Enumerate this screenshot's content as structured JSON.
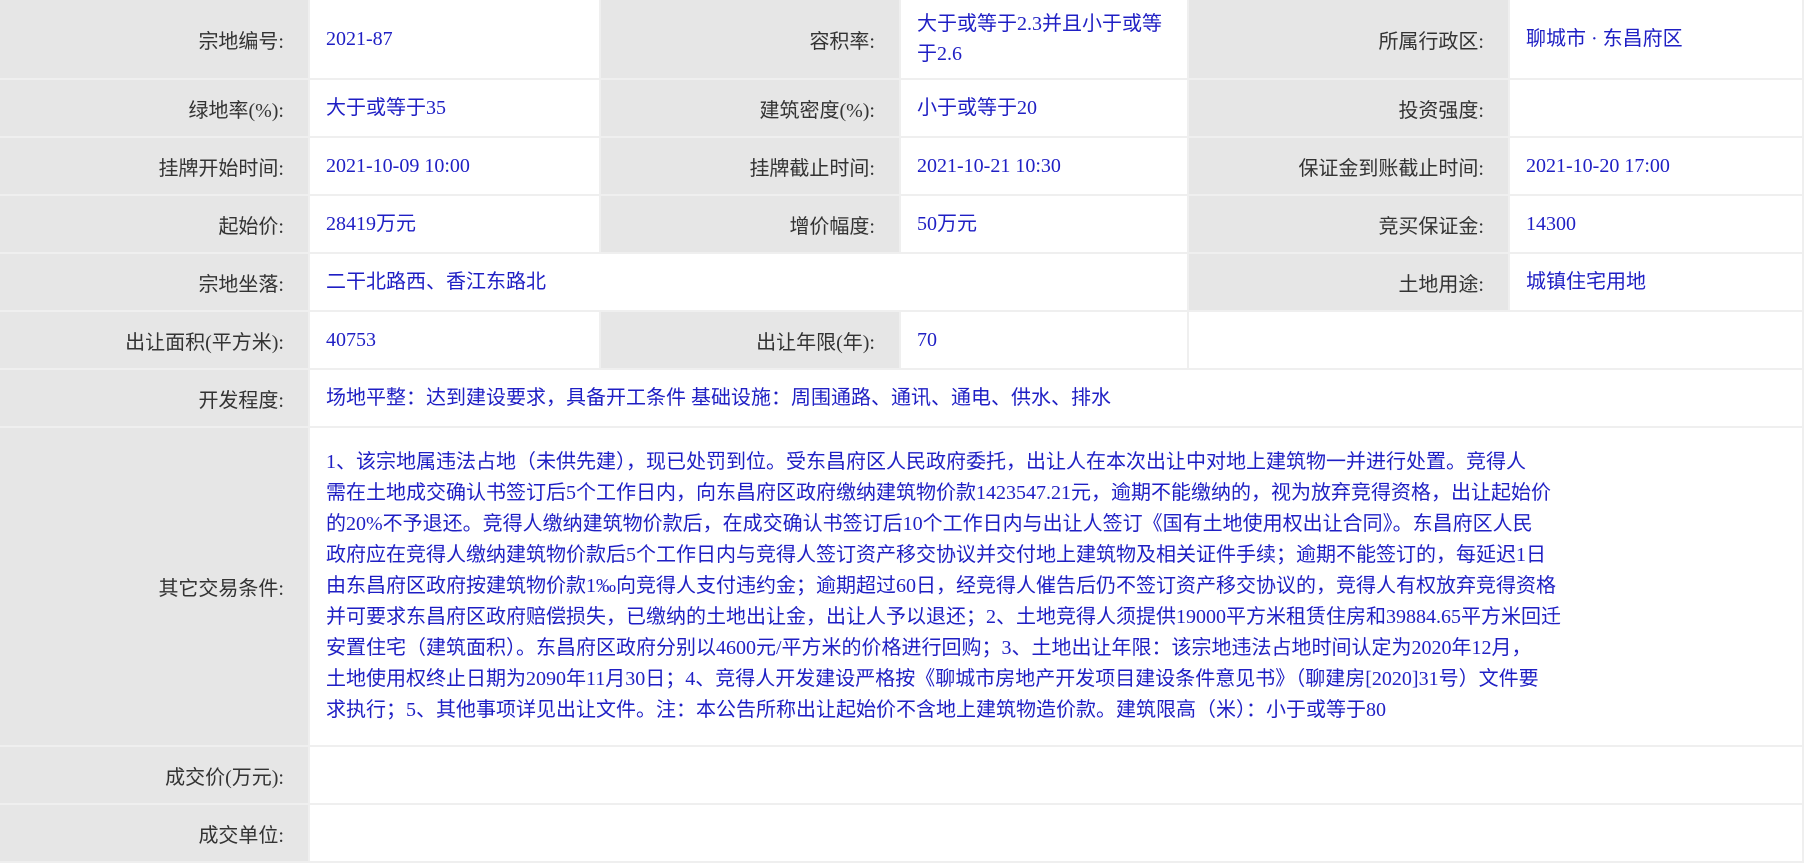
{
  "rows": {
    "parcel_no": {
      "label": "宗地编号:",
      "value": "2021-87"
    },
    "plot_ratio": {
      "label": "容积率:",
      "value": "大于或等于2.3并且小于或等于2.6"
    },
    "district": {
      "label": "所属行政区:",
      "value": "聊城市 · 东昌府区"
    },
    "green_ratio": {
      "label": "绿地率(%):",
      "value": "大于或等于35"
    },
    "building_density": {
      "label": "建筑密度(%):",
      "value": "小于或等于20"
    },
    "investment_intensity": {
      "label": "投资强度:",
      "value": ""
    },
    "listing_start": {
      "label": "挂牌开始时间:",
      "value": "2021-10-09 10:00"
    },
    "listing_end": {
      "label": "挂牌截止时间:",
      "value": "2021-10-21 10:30"
    },
    "deposit_deadline": {
      "label": "保证金到账截止时间:",
      "value": "2021-10-20 17:00"
    },
    "start_price": {
      "label": "起始价:",
      "value": "28419万元"
    },
    "increment": {
      "label": "增价幅度:",
      "value": "50万元"
    },
    "bid_deposit": {
      "label": "竞买保证金:",
      "value": "14300"
    },
    "location": {
      "label": "宗地坐落:",
      "value": "二干北路西、香江东路北"
    },
    "land_use": {
      "label": "土地用途:",
      "value": "城镇住宅用地"
    },
    "area": {
      "label": "出让面积(平方米):",
      "value": "40753"
    },
    "term": {
      "label": "出让年限(年):",
      "value": "70"
    },
    "development": {
      "label": "开发程度:",
      "value": "场地平整：达到建设要求，具备开工条件 基础设施：周围通路、通讯、通电、供水、排水"
    },
    "other_conditions": {
      "label": "其它交易条件:",
      "lines": [
        "1、该宗地属违法占地（未供先建），现已处罚到位。受东昌府区人民政府委托，出让人在本次出让中对地上建筑物一并进行处置。竞得人",
        "需在土地成交确认书签订后5个工作日内，向东昌府区政府缴纳建筑物价款1423547.21元，逾期不能缴纳的，视为放弃竞得资格，出让起始价",
        "的20%不予退还。竞得人缴纳建筑物价款后，在成交确认书签订后10个工作日内与出让人签订《国有土地使用权出让合同》。东昌府区人民",
        "政府应在竞得人缴纳建筑物价款后5个工作日内与竞得人签订资产移交协议并交付地上建筑物及相关证件手续；逾期不能签订的，每延迟1日",
        "由东昌府区政府按建筑物价款1‰向竞得人支付违约金；逾期超过60日，经竞得人催告后仍不签订资产移交协议的，竞得人有权放弃竞得资格",
        "并可要求东昌府区政府赔偿损失，已缴纳的土地出让金，出让人予以退还；2、土地竞得人须提供19000平方米租赁住房和39884.65平方米回迁",
        "安置住宅（建筑面积）。东昌府区政府分别以4600元/平方米的价格进行回购；3、土地出让年限：该宗地违法占地时间认定为2020年12月，",
        "土地使用权终止日期为2090年11月30日；4、竞得人开发建设严格按《聊城市房地产开发项目建设条件意见书》（聊建房[2020]31号）文件要",
        "求执行；5、其他事项详见出让文件。注：本公告所称出让起始价不含地上建筑物造价款。建筑限高（米）：小于或等于80"
      ]
    },
    "deal_price": {
      "label": "成交价(万元):",
      "value": ""
    },
    "deal_unit": {
      "label": "成交单位:",
      "value": ""
    }
  }
}
